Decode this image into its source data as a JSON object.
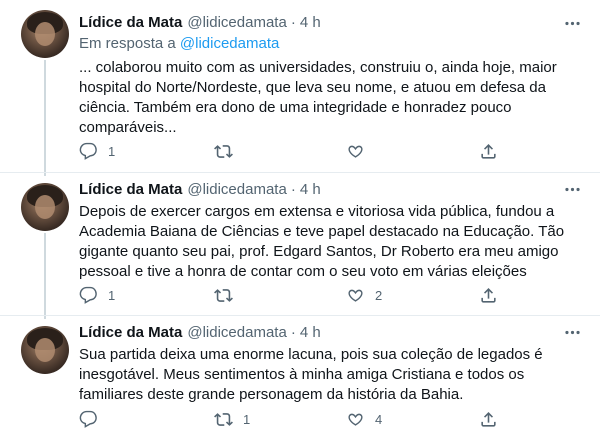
{
  "colors": {
    "text": "#0f1419",
    "muted": "#536471",
    "link": "#1d9bf0",
    "divider": "#e6ecf0"
  },
  "tweets": [
    {
      "name": "Lídice da Mata",
      "handle": "@lidicedamata",
      "dot": "·",
      "time": "4 h",
      "reply_prefix": "Em resposta a",
      "reply_mention": "@lidicedamata",
      "text": "... colaborou muito com as universidades, construiu o, ainda hoje, maior hospital do Norte/Nordeste, que leva seu nome, e atuou em defesa da ciência. Também era dono de uma integridade e honradez pouco comparáveis...",
      "replies": "1",
      "retweets": "",
      "likes": "",
      "icons": {
        "reply": "reply-icon",
        "retweet": "retweet-icon",
        "like": "heart-icon",
        "share": "share-icon",
        "more": "more-icon"
      }
    },
    {
      "name": "Lídice da Mata",
      "handle": "@lidicedamata",
      "dot": "·",
      "time": "4 h",
      "text": "Depois de exercer  cargos em extensa e vitoriosa vida pública, fundou a Academia Baiana de Ciências e teve papel destacado na Educação. Tão gigante quanto seu pai, prof. Edgard Santos, Dr Roberto era meu amigo pessoal e tive a honra de contar com o seu voto em várias eleições",
      "replies": "1",
      "retweets": "",
      "likes": "2"
    },
    {
      "name": "Lídice da Mata",
      "handle": "@lidicedamata",
      "dot": "·",
      "time": "4 h",
      "text": "Sua partida deixa uma enorme lacuna, pois sua coleção de legados é inesgotável. Meus sentimentos à minha amiga Cristiana e todos os familiares deste grande personagem da história da Bahia.",
      "replies": "",
      "retweets": "1",
      "likes": "4"
    }
  ]
}
